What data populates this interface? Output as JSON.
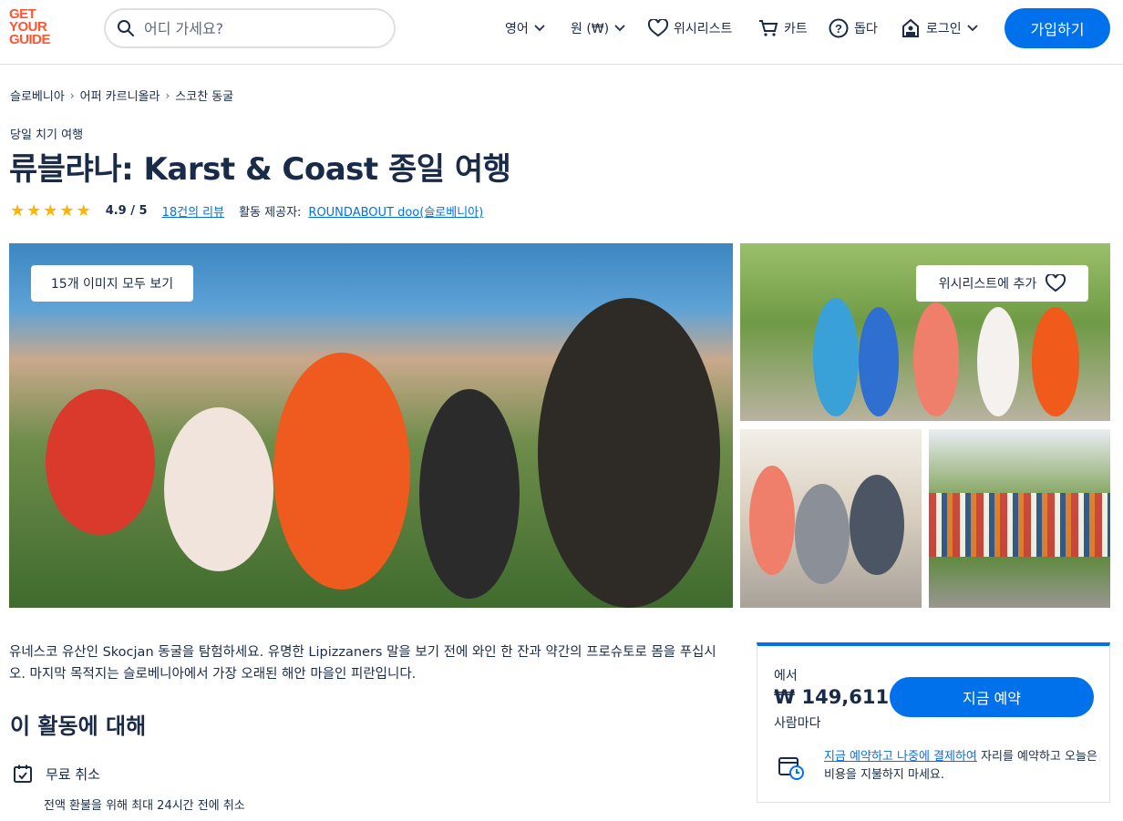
{
  "header": {
    "logo_lines": [
      "GET",
      "YOUR",
      "GUIDE"
    ],
    "search_placeholder": "어디 가세요?",
    "language": "영어",
    "currency": "원 (₩)",
    "wishlist": "위시리스트",
    "cart": "카트",
    "help": "돕다",
    "login": "로그인",
    "signup": "가입하기"
  },
  "breadcrumb": [
    "슬로베니아",
    "어퍼 카르니올라",
    "스코찬 동굴"
  ],
  "activity": {
    "category": "당일 치기 여행",
    "title": "류블랴나: Karst & Coast 종일 여행",
    "rating": 4.9,
    "rating_text": "4.9 / 5",
    "reviews": "18건의 리뷰",
    "provider_label": "활동 제공자:",
    "provider": "ROUNDABOUT doo(슬로베니아)"
  },
  "gallery": {
    "view_all": "15개 이미지 모두 보기",
    "add_wishlist": "위시리스트에 추가"
  },
  "description": "유네스코 유산인 Skocjan 동굴을 탐험하세요. 유명한 Lipizzaners 말을 보기 전에 와인 한 잔과 약간의 프로슈토로 몸을 푸십시오. 마지막 목적지는 슬로베니아에서 가장 오래된 해안 마을인 피란입니다.",
  "about": {
    "title": "이 활동에 대해",
    "free_cancel": "무료 취소",
    "free_cancel_sub": "전액 환불을 위해 최대 24시간 전에 취소"
  },
  "booking": {
    "from": "에서",
    "price": "₩ 149,611",
    "per": "사람마다",
    "book_now": "지금 예약",
    "reserve_link": "지금 예약하고 나중에 결제하여",
    "reserve_rest": " 자리를 예약하고 오늘은 비용을 지불하지 마세요."
  },
  "colors": {
    "accent": "#0071eb",
    "brand": "#ff5533",
    "star": "#ffb400",
    "text": "#1a2b49"
  }
}
